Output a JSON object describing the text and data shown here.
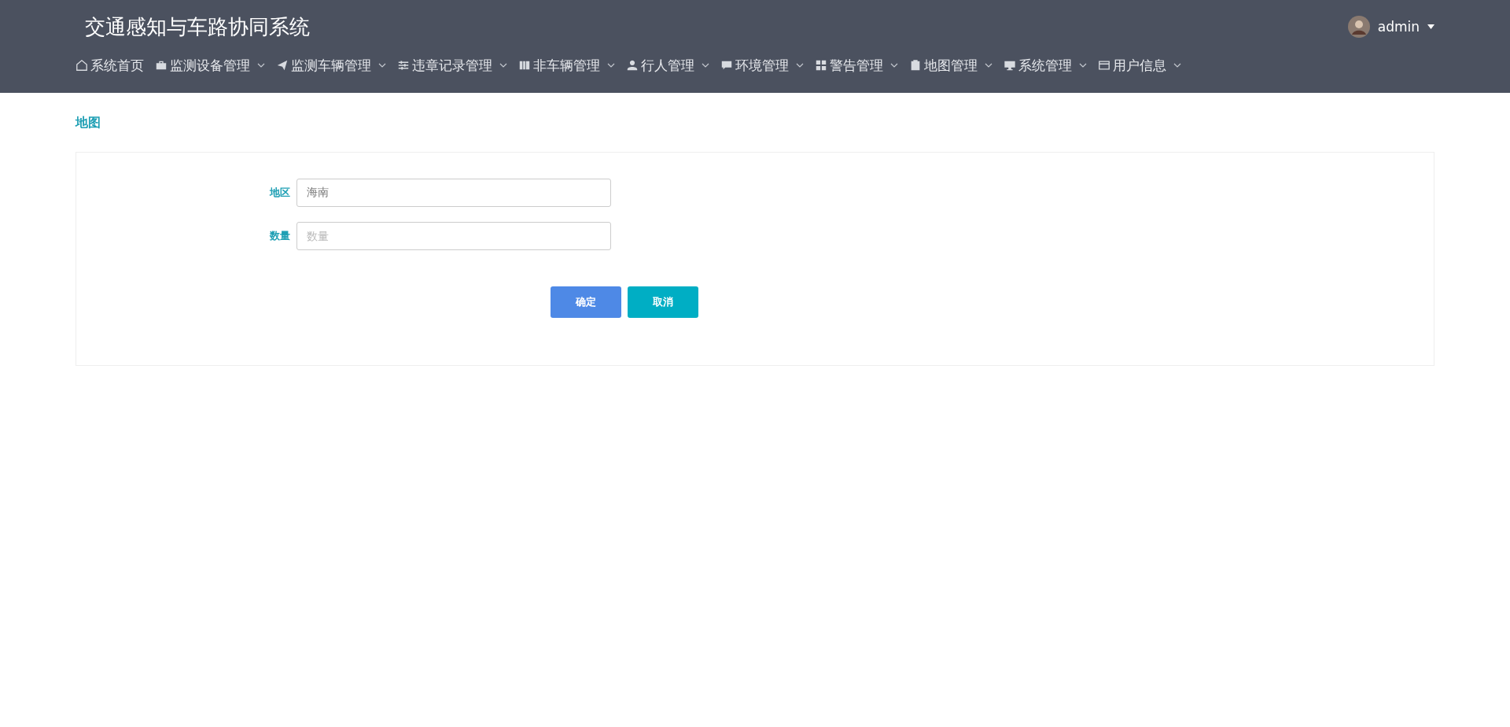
{
  "header": {
    "title": "交通感知与车路协同系统",
    "user": {
      "name": "admin"
    }
  },
  "nav": [
    {
      "label": "系统首页",
      "dropdown": false
    },
    {
      "label": "监测设备管理",
      "dropdown": true
    },
    {
      "label": "监测车辆管理",
      "dropdown": true
    },
    {
      "label": "违章记录管理",
      "dropdown": true
    },
    {
      "label": "非车辆管理",
      "dropdown": true
    },
    {
      "label": "行人管理",
      "dropdown": true
    },
    {
      "label": "环境管理",
      "dropdown": true
    },
    {
      "label": "警告管理",
      "dropdown": true
    },
    {
      "label": "地图管理",
      "dropdown": true
    },
    {
      "label": "系统管理",
      "dropdown": true
    },
    {
      "label": "用户信息",
      "dropdown": true
    }
  ],
  "breadcrumb": "地图",
  "form": {
    "fields": [
      {
        "label": "地区",
        "value": "海南"
      },
      {
        "label": "数量",
        "placeholder": "数量"
      }
    ],
    "buttons": [
      {
        "label": "确定",
        "kind": "primary"
      },
      {
        "label": "取消",
        "kind": "cancel"
      }
    ]
  }
}
